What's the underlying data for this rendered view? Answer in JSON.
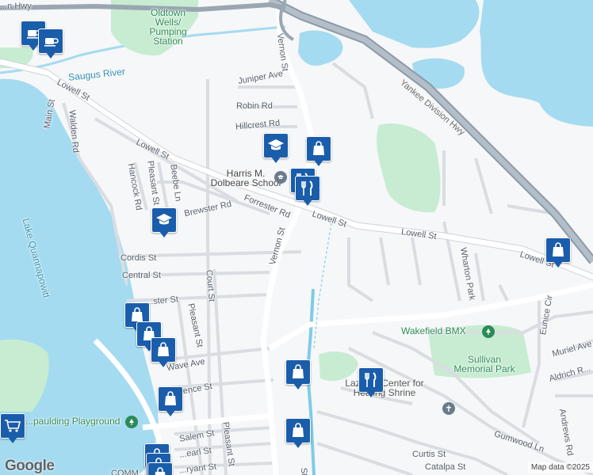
{
  "map": {
    "attribution": "Map data ©2025",
    "logo": "Google"
  },
  "streets": {
    "lowell_st_w": "Lowell St",
    "lowell_st_mid": "Lowell St",
    "lowell_st_center": "Lowell St",
    "lowell_st_east": "Lowell St",
    "lowell_st_far_east": "Lowell St",
    "main_st": "Main St",
    "walden_rd": "Walden Rd",
    "hancock_rd": "Hancock Rd",
    "pleasant_st_n": "Pleasant St",
    "beebe_ln": "Beebe Ln",
    "brewster_rd": "Brewster Rd",
    "forrester_rd": "Forrester Rd",
    "vernon_st_n": "Vernon St",
    "vernon_st_s": "Vernon St",
    "juniper_ave": "Juniper Ave",
    "robin_rd": "Robin Rd",
    "hillcrest_rd": "Hillcrest Rd",
    "cordis_st": "Cordis St",
    "central_st": "Central St",
    "court_st": "Court St",
    "chester_st": "...ster St",
    "pleasant_st_mid": "Pleasant St",
    "wave_ave": "Wave Ave",
    "lawrence_st": "...wrence St",
    "salem_st": "Salem St",
    "pearl_st": "...earl St",
    "bryant_st": "...ryant St",
    "pleasant_st_s": "Pleasant St",
    "wharton_park": "Wharton Park",
    "eunice_cir": "Eunice Cir",
    "muriel_ave": "Muriel Ave",
    "aldrich_rd": "Aldrich R...",
    "andrews_rd": "Andrews Rd",
    "gumwood_ln": "Gumwood Ln",
    "curtis_st": "Curtis St",
    "catalpa_st": "Catalpa St",
    "yankee_hwy": "Yankee Division Hwy",
    "nw_hwy": "...n Hwy",
    "comm": "COMM...",
    "st_bottom": "St"
  },
  "water": {
    "saugus_river": "Saugus River",
    "lake": "Lake Quannapowitt"
  },
  "places": {
    "oldtown": "Oldtown\nWells/\nPumping\nStation",
    "school": "Harris M.\nDolbeare School",
    "bmx": "Wakefield BMX",
    "sullivan": "Sullivan\nMemorial Park",
    "lazarus": "Lazarus Center for\nHealing Shrine",
    "spaulding": "...paulding Playground"
  },
  "pins": [
    {
      "type": "cafe-icon",
      "label": "cafe"
    },
    {
      "type": "cafe-icon",
      "label": "cafe"
    },
    {
      "type": "school-icon",
      "label": "school"
    },
    {
      "type": "shopping-bag-icon",
      "label": "shop"
    },
    {
      "type": "restaurant-icon",
      "label": "restaurant"
    },
    {
      "type": "restaurant-icon",
      "label": "restaurant"
    },
    {
      "type": "school-icon",
      "label": "school"
    },
    {
      "type": "shopping-bag-icon",
      "label": "shop"
    },
    {
      "type": "shopping-bag-icon",
      "label": "shop"
    },
    {
      "type": "shopping-bag-icon",
      "label": "shop"
    },
    {
      "type": "shopping-bag-icon",
      "label": "shop"
    },
    {
      "type": "shopping-bag-icon",
      "label": "shop"
    },
    {
      "type": "shopping-bag-icon",
      "label": "shop"
    },
    {
      "type": "restaurant-icon",
      "label": "restaurant"
    },
    {
      "type": "shopping-bag-icon",
      "label": "shop"
    },
    {
      "type": "shopping-cart-icon",
      "label": "grocery"
    },
    {
      "type": "shopping-bag-icon",
      "label": "shop"
    },
    {
      "type": "shopping-bag-icon",
      "label": "shop"
    },
    {
      "type": "shopping-bag-icon",
      "label": "shop"
    }
  ],
  "colors": {
    "water": "#a4dbf0",
    "park": "#c7ecd2",
    "pin": "#1a5dab",
    "highway": "#8c9aa8"
  }
}
